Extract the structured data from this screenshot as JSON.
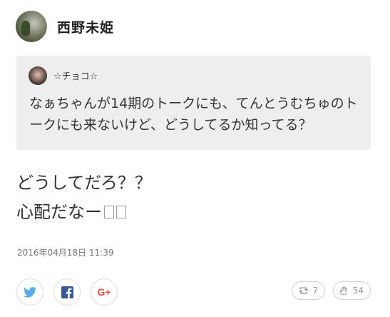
{
  "post": {
    "author": "西野未姫",
    "quote": {
      "author": "☆チョコ☆",
      "text": "なぁちゃんが14期のトークにも、てんとうむちゅのトークにも来ないけど、どうしてるか知ってる？"
    },
    "body_lines": [
      "どうしてだろ？？",
      "心配だなー"
    ],
    "timestamp": "2016年04月18日 11:39"
  },
  "share": {
    "twitter_icon": "twitter-icon",
    "facebook_icon": "facebook-icon",
    "googleplus_label": "G+"
  },
  "counters": {
    "retweet": "7",
    "like": "54"
  },
  "colors": {
    "twitter": "#55acee",
    "facebook": "#3b5998",
    "googleplus": "#dd4b39",
    "quote_bg": "#eeeeee"
  }
}
